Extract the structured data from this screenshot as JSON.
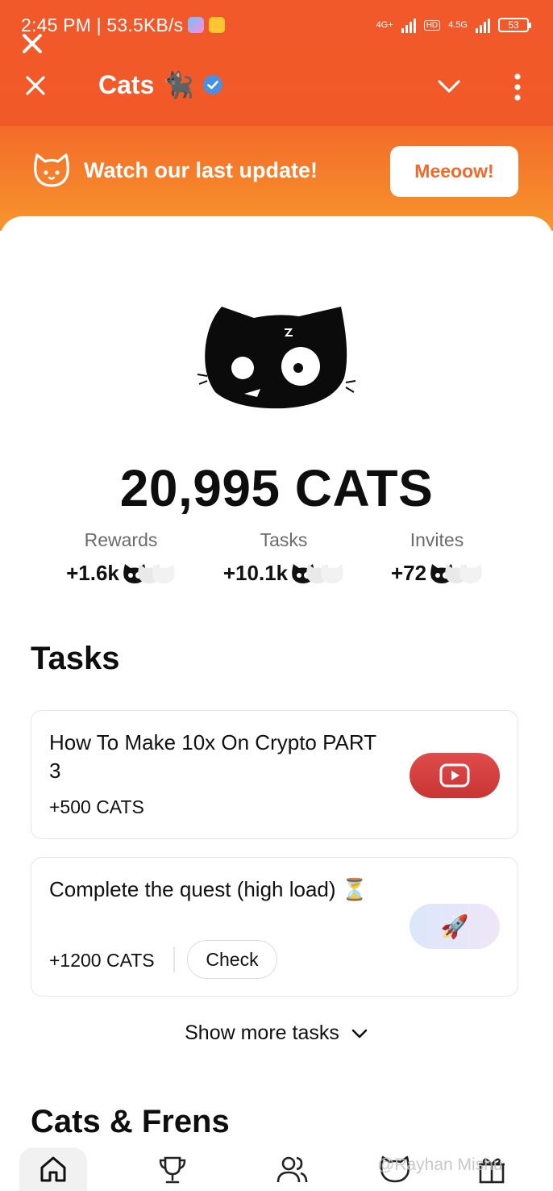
{
  "status_bar": {
    "time_speed": "2:45 PM | 53.5KB/s",
    "network_1": "4G+",
    "hd": "HD",
    "network_2": "4.5G",
    "battery": "53"
  },
  "header": {
    "title": "Cats",
    "title_emoji": "🐈‍⬛"
  },
  "banner": {
    "text": "Watch our last update!",
    "button_label": "Meeoow!"
  },
  "balance": {
    "text": "20,995 CATS"
  },
  "stats": [
    {
      "label": "Rewards",
      "value": "+1.6k"
    },
    {
      "label": "Tasks",
      "value": "+10.1k"
    },
    {
      "label": "Invites",
      "value": "+72"
    }
  ],
  "tasks_section": {
    "title": "Tasks",
    "items": [
      {
        "title": "How To Make 10x On Crypto PART 3",
        "reward": "+500 CATS",
        "action_icon": "youtube-play-icon"
      },
      {
        "title": "Complete the quest (high load) ⏳",
        "reward": "+1200 CATS",
        "check_label": "Check",
        "action_icon": "rocket-icon"
      }
    ],
    "show_more": "Show more tasks"
  },
  "frens_section": {
    "title": "Cats & Frens"
  },
  "bottom_nav": [
    "home-icon",
    "trophy-icon",
    "friends-icon",
    "cat-icon",
    "gift-icon"
  ],
  "watermark": "@Rayhan Mishu",
  "colors": {
    "brand_orange": "#f15a28",
    "banner_orange": "#f7952c",
    "youtube_red": "#d63d3d"
  }
}
